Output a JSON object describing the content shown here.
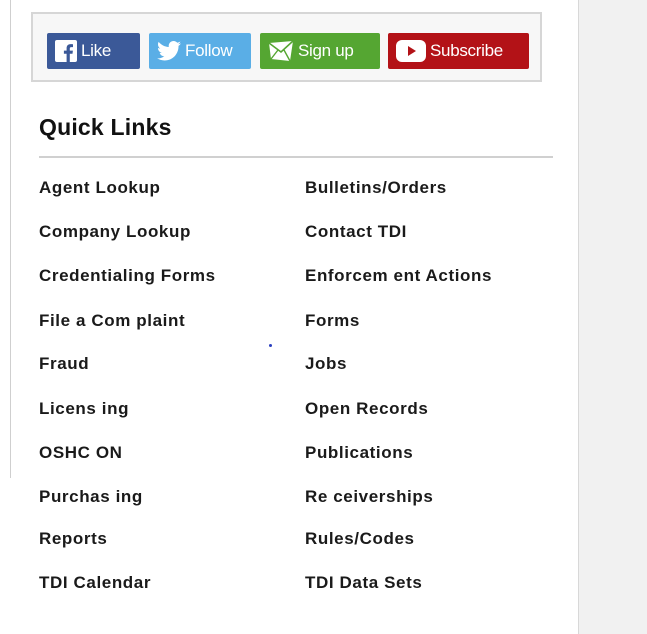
{
  "social": {
    "like": "Like",
    "follow": "Follow",
    "signup": "Sign up",
    "subscribe": "Subscribe"
  },
  "quick_links": {
    "title": "Quick Links",
    "left": [
      "Agent Lookup",
      "Company Lookup",
      "Credentialing Forms",
      "File a Com plaint",
      "Fraud",
      "Licens ing",
      "OSHC ON",
      "Purchas ing",
      "Reports",
      "TDI Calendar"
    ],
    "right": [
      "Bulletins/Orders",
      "Contact TDI",
      "Enforcem ent Actions",
      "Forms",
      "Jobs",
      "Open Records",
      "Publications",
      "Re ceiverships",
      "Rules/Codes",
      "TDI Data Sets"
    ]
  },
  "colors": {
    "facebook": "#3b5998",
    "twitter": "#5aaee6",
    "signup": "#55a632",
    "youtube": "#b31217"
  }
}
